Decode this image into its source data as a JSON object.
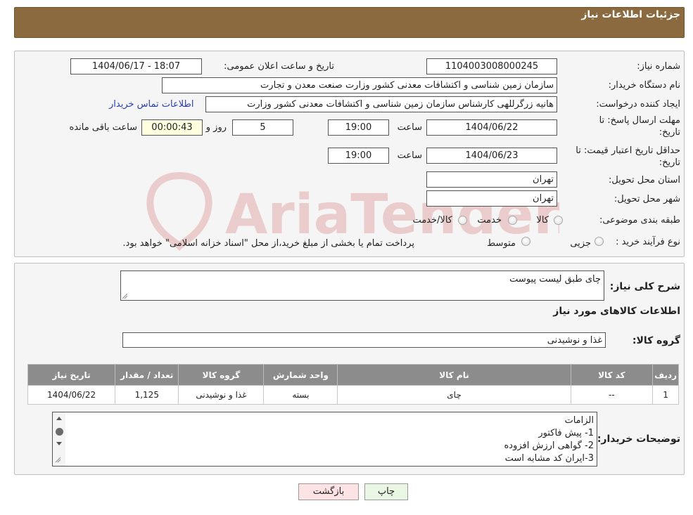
{
  "header": {
    "title": "جزئیات اطلاعات نیاز"
  },
  "form": {
    "need_number_label": "شماره نیاز:",
    "need_number": "1104003008000245",
    "announce_label": "تاریخ و ساعت اعلان عمومی:",
    "announce_value": "1404/06/17 - 18:07",
    "buyer_org_label": "نام دستگاه خریدار:",
    "buyer_org": "سازمان زمین شناسی و اکتشافات معدنی کشور وزارت صنعت معدن و تجارت",
    "creator_label": "ایجاد کننده درخواست:",
    "creator": "هانیه زرگرللهی کارشناس سازمان زمین شناسی و اکتشافات معدنی کشور وزارت",
    "contact_link": "اطلاعات تماس خریدار",
    "deadline_label_1": "مهلت ارسال پاسخ: تا",
    "deadline_label_2": "تاریخ:",
    "deadline_date": "1404/06/22",
    "time_label": "ساعت",
    "deadline_time": "19:00",
    "days_value": "5",
    "days_label": "روز و",
    "remaining_time": "00:00:43",
    "remaining_label": "ساعت باقی مانده",
    "validity_label_1": "حداقل تاریخ اعتبار قیمت: تا",
    "validity_label_2": "تاریخ:",
    "validity_date": "1404/06/23",
    "validity_time": "19:00",
    "province_label": "استان محل تحویل:",
    "province": "تهران",
    "city_label": "شهر محل تحویل:",
    "city": "تهران",
    "category_label": "طبقه بندی موضوعی:",
    "category_options": [
      "کالا",
      "خدمت",
      "کالا/خدمت"
    ],
    "process_label": "نوع فرآیند خرید :",
    "process_options": [
      "جزیی",
      "متوسط"
    ],
    "process_note": "پرداخت تمام یا بخشی از مبلغ خرید،از محل \"اسناد خزانه اسلامی\" خواهد بود."
  },
  "description": {
    "label": "شرح کلی نیاز:",
    "value": "چای طبق لیست پیوست"
  },
  "goods": {
    "section_title": "اطلاعات کالاهای مورد نیاز",
    "group_label": "گروه کالا:",
    "group_value": "غذا و نوشیدنی",
    "columns": [
      "ردیف",
      "کد کالا",
      "نام کالا",
      "واحد شمارش",
      "گروه کالا",
      "تعداد / مقدار",
      "تاریخ نیاز"
    ],
    "rows": [
      [
        "1",
        "--",
        "چای",
        "بسته",
        "غذا و نوشیدنی",
        "1,125",
        "1404/06/22"
      ]
    ]
  },
  "buyer_notes": {
    "label": "توضیحات خریدار:",
    "lines": [
      "الزامات",
      "1-  پیش فاکتور",
      "2- گواهی ارزش افزوده",
      "3-ایران کد مشابه است"
    ]
  },
  "buttons": {
    "print": "چاپ",
    "back": "بازگشت"
  },
  "watermark": {
    "text": "AriaTender.neT"
  },
  "colors": {
    "header_bg": "#8a6a3e",
    "table_header": "#8c8c8c",
    "link": "#2b3ea8",
    "back_button": "#fde3e3",
    "print_button": "#e8f6e3"
  }
}
